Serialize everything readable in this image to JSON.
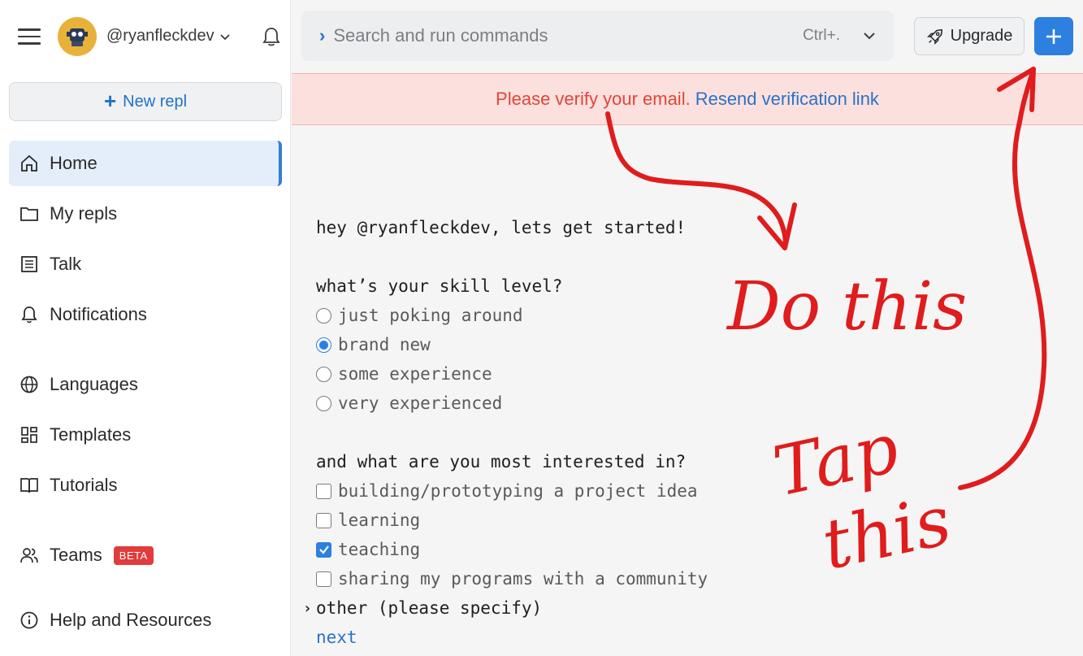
{
  "header": {
    "username": "@ryanfleckdev",
    "search_placeholder": "Search and run commands",
    "search_shortcut": "Ctrl+.",
    "upgrade_label": "Upgrade"
  },
  "sidebar": {
    "new_repl_label": "New repl",
    "items": [
      {
        "label": "Home",
        "icon": "home-icon"
      },
      {
        "label": "My repls",
        "icon": "folder-icon"
      },
      {
        "label": "Talk",
        "icon": "list-icon"
      },
      {
        "label": "Notifications",
        "icon": "bell-icon"
      },
      {
        "label": "Languages",
        "icon": "globe-icon"
      },
      {
        "label": "Templates",
        "icon": "grid-icon"
      },
      {
        "label": "Tutorials",
        "icon": "book-icon"
      },
      {
        "label": "Teams",
        "icon": "users-icon",
        "badge": "BETA"
      },
      {
        "label": "Help and Resources",
        "icon": "info-icon"
      }
    ]
  },
  "banner": {
    "warning": "Please verify your email.",
    "link": "Resend verification link"
  },
  "onboarding": {
    "greeting": "hey @ryanfleckdev, lets get started!",
    "skill_question": "what’s your skill level?",
    "skill_options": [
      "just poking around",
      "brand new",
      "some experience",
      "very experienced"
    ],
    "skill_selected": "brand new",
    "interest_question": "and what are you most interested in?",
    "interest_options": [
      "building/prototyping a project idea",
      "learning",
      "teaching",
      "sharing my programs with a community"
    ],
    "interest_checked": [
      "teaching"
    ],
    "other_label": "other (please specify)",
    "next_label": "next"
  },
  "annotations": {
    "do_this": "Do this",
    "tap": "Tap",
    "this": "this"
  },
  "colors": {
    "accent": "#2d7fe0",
    "warning": "#e2453a",
    "annotation": "#e01c1c",
    "badge": "#e23b3b"
  }
}
